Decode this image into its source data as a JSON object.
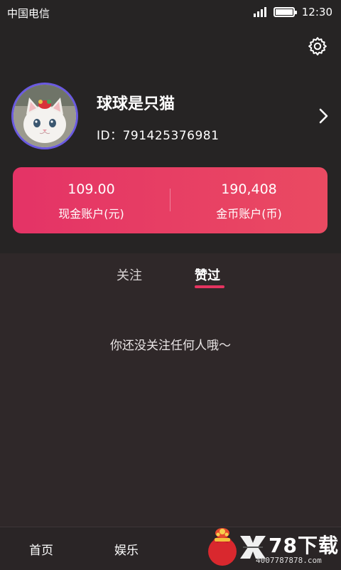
{
  "status_bar": {
    "carrier": "中国电信",
    "time": "12:30",
    "battery_level": 1.0
  },
  "profile": {
    "username": "球球是只猫",
    "user_id": "ID：791425376981",
    "avatar_icon": "cat-avatar"
  },
  "wallet": {
    "cash_amount": "109.00",
    "cash_label": "现金账户(元)",
    "coin_amount": "190,408",
    "coin_label": "金币账户(币)"
  },
  "tabs": [
    {
      "label": "关注",
      "active": false
    },
    {
      "label": "赞过",
      "active": true
    }
  ],
  "empty_message": "你还没关注任何人哦～",
  "bottom_nav": {
    "items": [
      {
        "label": "首页"
      },
      {
        "label": "娱乐"
      }
    ]
  },
  "watermark": {
    "brand": "78下载",
    "url": "4007787878.com"
  },
  "colors": {
    "accent": "#e63460",
    "wallet_start": "#e43366",
    "wallet_end": "#ea4a62",
    "avatar_ring": "#6a5ae0",
    "background": "#2f2829",
    "header_bg": "#262424"
  }
}
